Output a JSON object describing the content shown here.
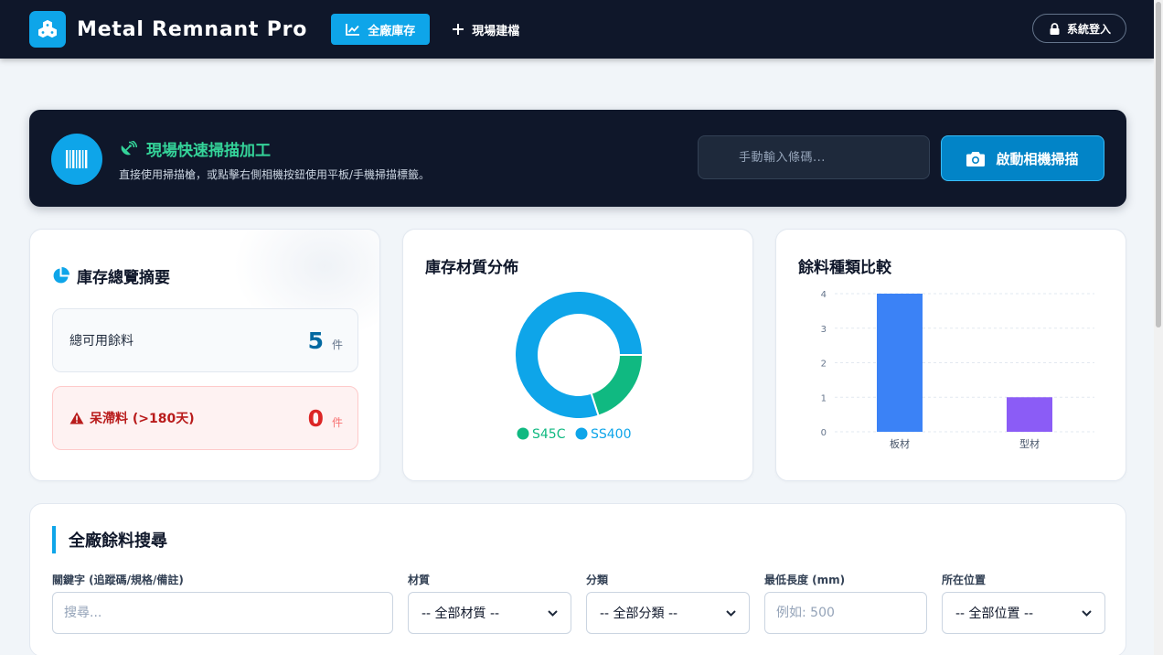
{
  "app": {
    "title": "Metal Remnant Pro"
  },
  "nav": {
    "items": [
      {
        "label": "全廠庫存",
        "active": true
      },
      {
        "label": "現場建檔",
        "active": false
      }
    ],
    "login_label": "系統登入"
  },
  "scan": {
    "title": "現場快速掃描加工",
    "subtitle": "直接使用掃描槍，或點擊右側相機按鈕使用平板/手機掃描標籤。",
    "input_placeholder": "手動輸入條碼...",
    "camera_label": "啟動相機掃描"
  },
  "summary": {
    "title": "庫存總覽摘要",
    "total": {
      "label": "總可用餘料",
      "value": "5",
      "unit": "件"
    },
    "stale": {
      "label": "呆滯料 (>180天)",
      "value": "0",
      "unit": "件"
    }
  },
  "material_chart": {
    "title": "庫存材質分佈",
    "chart_data": {
      "type": "pie",
      "variant": "doughnut",
      "labels": [
        "S45C",
        "SS400"
      ],
      "values": [
        1,
        4
      ],
      "colors": [
        "#10b981",
        "#0ea5e9"
      ],
      "legend_position": "bottom"
    }
  },
  "type_chart": {
    "title": "餘料種類比較",
    "chart_data": {
      "type": "bar",
      "categories": [
        "板材",
        "型材"
      ],
      "values": [
        4,
        1
      ],
      "colors": [
        "#3b82f6",
        "#8b5cf6"
      ],
      "ylim": [
        0,
        4
      ],
      "yticks": [
        "0",
        "1",
        "2",
        "3",
        "4"
      ],
      "grid": true,
      "legend": false
    }
  },
  "search": {
    "title": "全廠餘料搜尋",
    "fields": {
      "keyword": {
        "label": "關鍵字 (追蹤碼/規格/備註)",
        "placeholder": "搜尋..."
      },
      "material": {
        "label": "材質",
        "value": "-- 全部材質 --"
      },
      "category": {
        "label": "分類",
        "value": "-- 全部分類 --"
      },
      "min_length": {
        "label": "最低長度 (mm)",
        "placeholder": "例如: 500"
      },
      "location": {
        "label": "所在位置",
        "value": "-- 全部位置 --"
      }
    }
  },
  "colors": {
    "navy": "#0f172a",
    "accent": "#0ea5e9",
    "green": "#10b981",
    "danger": "#dc2626",
    "bar_plate": "#3b82f6",
    "bar_profile": "#8b5cf6"
  }
}
